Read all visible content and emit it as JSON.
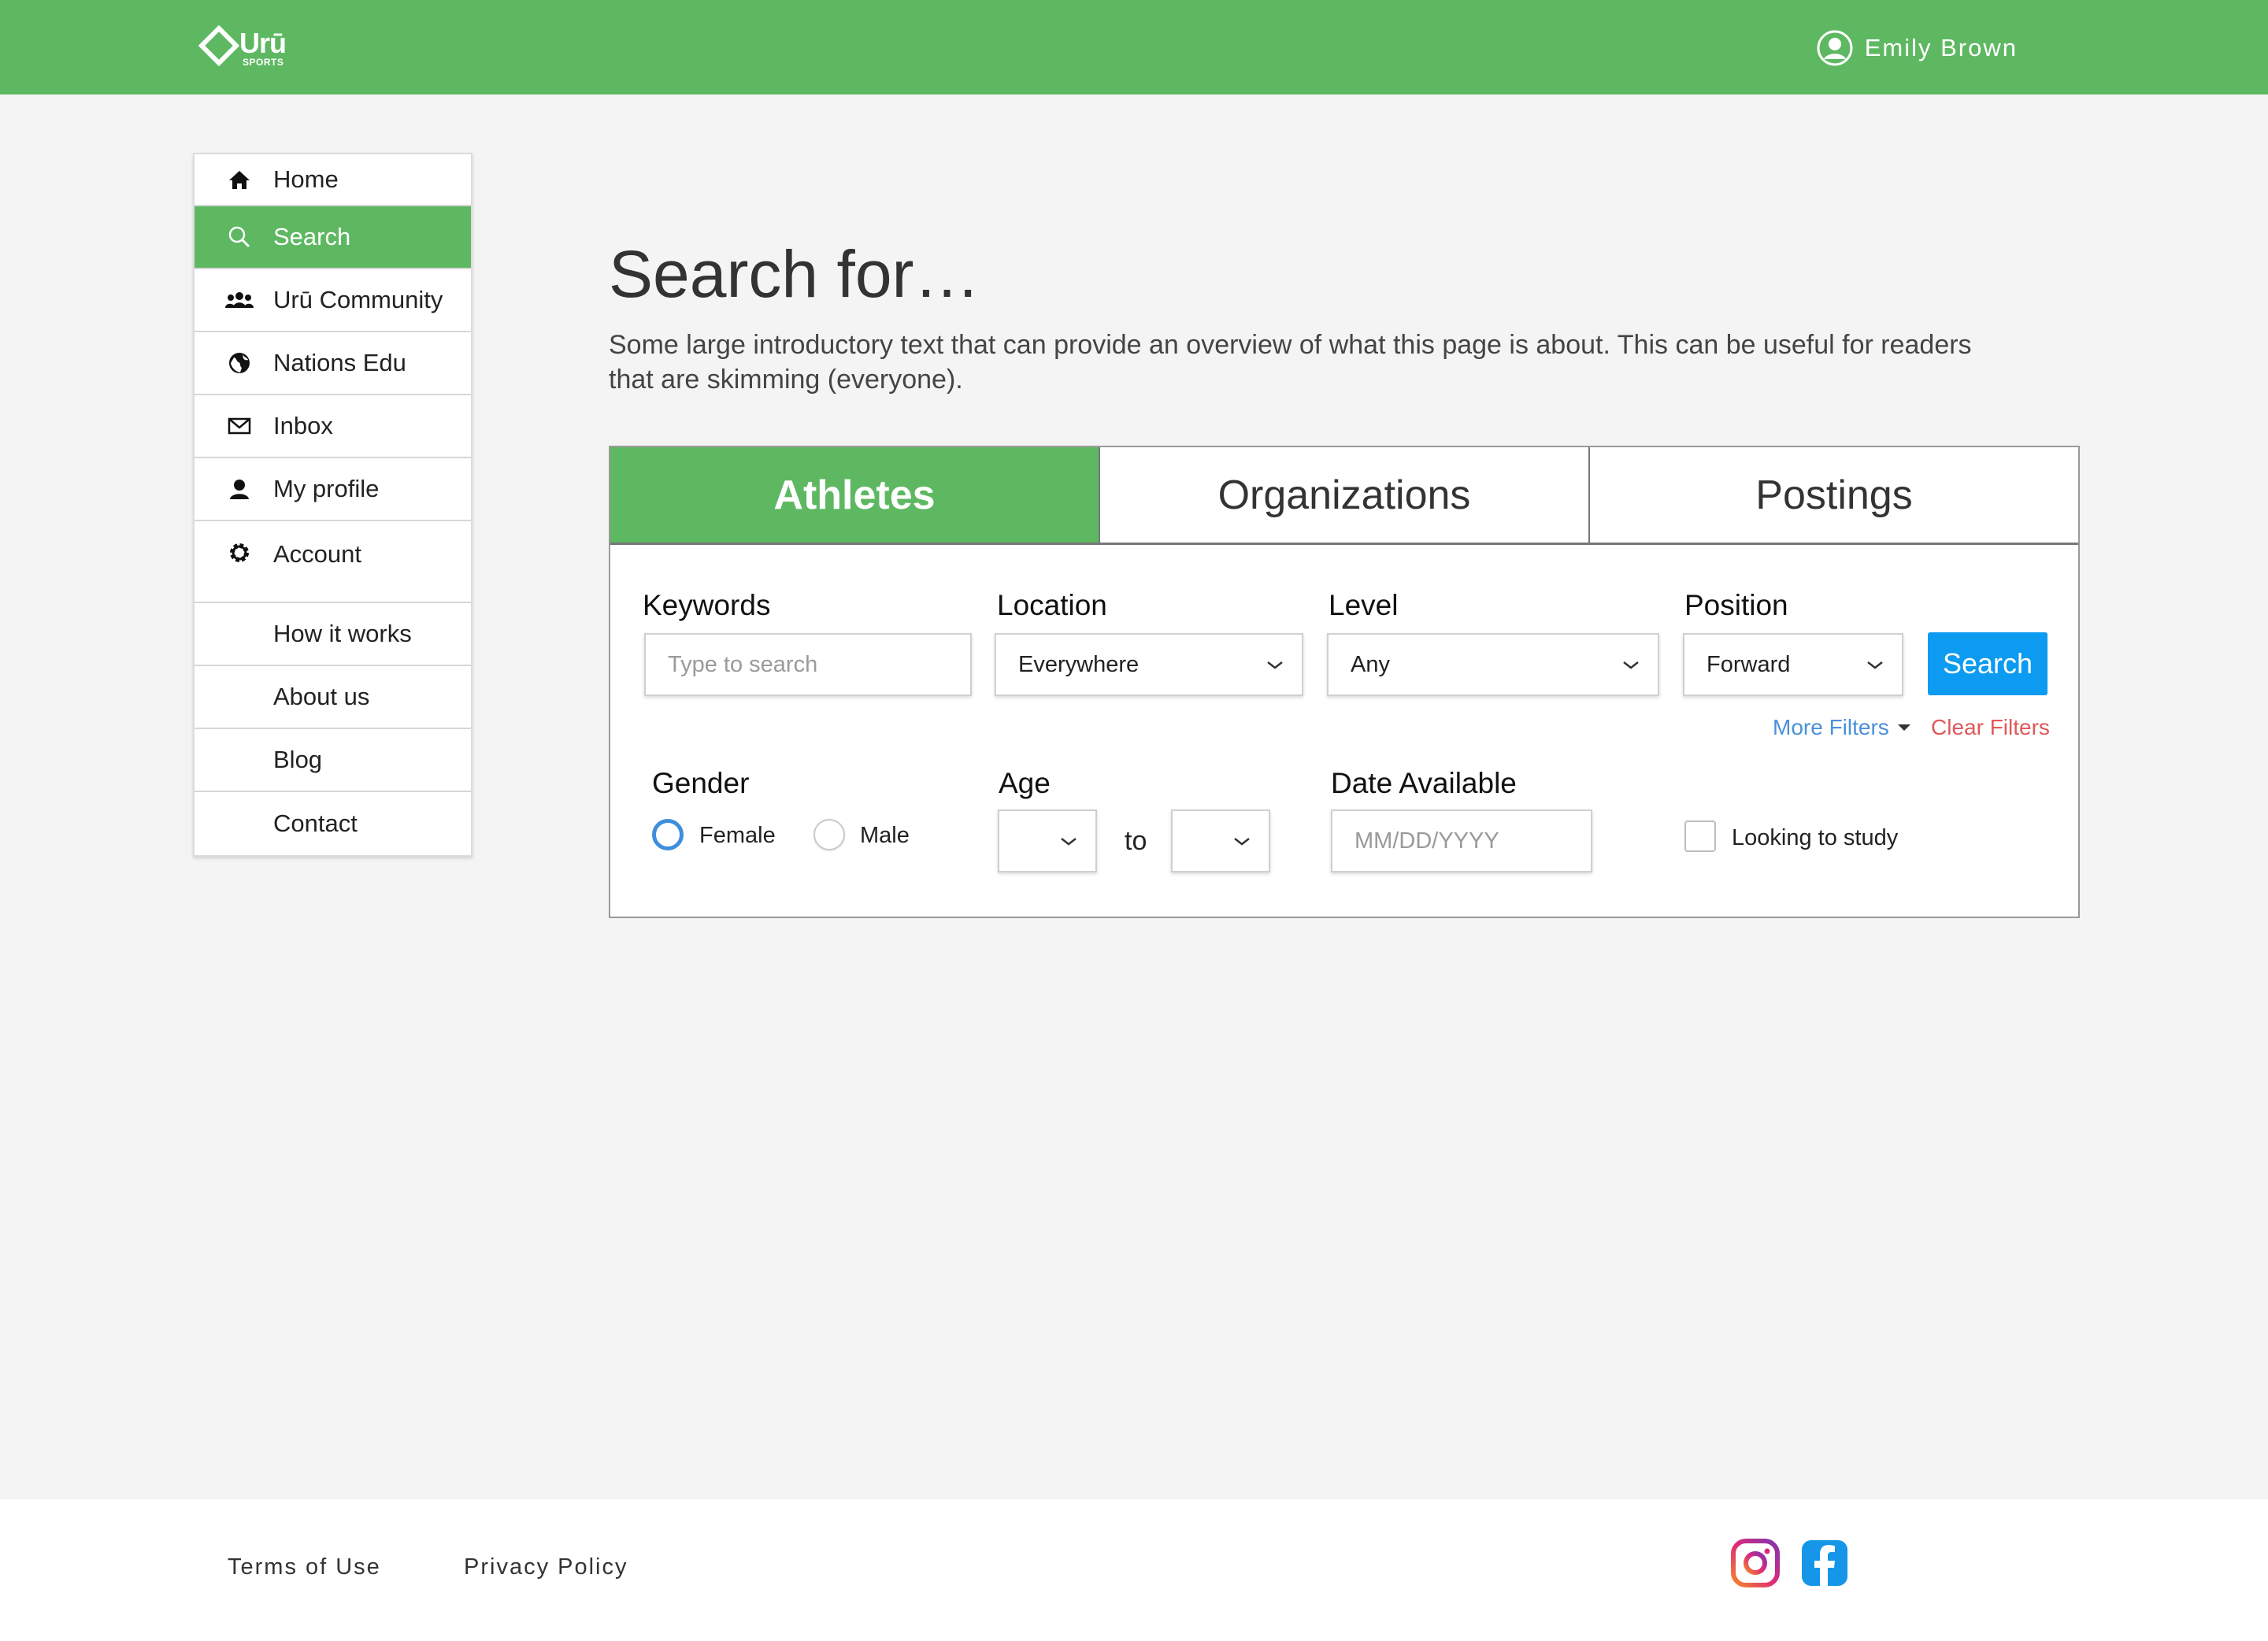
{
  "header": {
    "logo_text": "Urū",
    "logo_sub": "SPORTS",
    "user_name": "Emily Brown",
    "accent_color": "#5eb862"
  },
  "sidebar": {
    "items": [
      {
        "label": "Home",
        "icon": "home-icon"
      },
      {
        "label": "Search",
        "icon": "search-icon",
        "active": true
      },
      {
        "label": "Urū Community",
        "icon": "community-icon"
      },
      {
        "label": "Nations Edu",
        "icon": "globe-icon"
      },
      {
        "label": "Inbox",
        "icon": "envelope-icon"
      },
      {
        "label": "My profile",
        "icon": "user-icon"
      },
      {
        "label": "Account",
        "icon": "gear-icon"
      },
      {
        "label": "How it works"
      },
      {
        "label": "About us"
      },
      {
        "label": "Blog"
      },
      {
        "label": "Contact"
      }
    ]
  },
  "main": {
    "title": "Search for…",
    "intro": "Some large introductory text that can provide an overview of what this page is about. This can be useful for readers that are skimming (everyone).",
    "tabs": [
      {
        "label": "Athletes",
        "active": true
      },
      {
        "label": "Organizations"
      },
      {
        "label": "Postings"
      }
    ],
    "filters": {
      "keywords": {
        "label": "Keywords",
        "placeholder": "Type to search"
      },
      "location": {
        "label": "Location",
        "value": "Everywhere"
      },
      "level": {
        "label": "Level",
        "value": "Any"
      },
      "position": {
        "label": "Position",
        "value": "Forward"
      },
      "search_button": "Search",
      "more_filters": "More Filters",
      "clear_filters": "Clear Filters",
      "gender": {
        "label": "Gender",
        "options": [
          "Female",
          "Male"
        ],
        "selected": "Female"
      },
      "age": {
        "label": "Age",
        "to_label": "to"
      },
      "date_available": {
        "label": "Date Available",
        "placeholder": "MM/DD/YYYY"
      },
      "looking_to_study": {
        "label": "Looking to study",
        "checked": false
      }
    }
  },
  "footer": {
    "terms": "Terms of Use",
    "privacy": "Privacy Policy",
    "social": [
      "instagram-icon",
      "facebook-icon"
    ]
  }
}
